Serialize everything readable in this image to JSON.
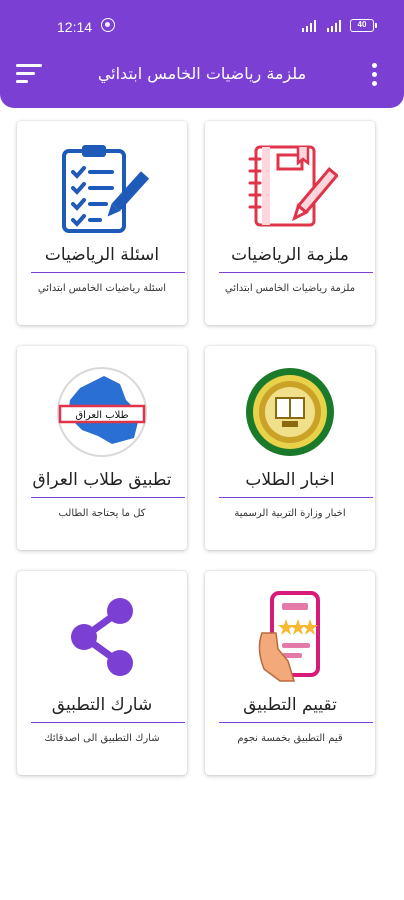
{
  "status_bar": {
    "time": "12:14",
    "battery": "40"
  },
  "app_bar": {
    "title": "ملزمة رياضيات الخامس ابتدائي",
    "menu_icon": "hamburger-menu-icon",
    "more_icon": "more-vert-icon"
  },
  "colors": {
    "primary": "#7b3fd4",
    "rule": "#7b3fd4"
  },
  "cards": [
    {
      "title": "ملزمة الرياضيات",
      "subtitle": "ملزمة رياضيات الخامس ابتدائي",
      "icon": "notebook-pencil-icon"
    },
    {
      "title": "اسئلة الرياضيات",
      "subtitle": "اسئلة رياضيات الخامس ابتدائي",
      "icon": "clipboard-checklist-icon"
    },
    {
      "title": "اخبار الطلاب",
      "subtitle": "اخبار وزارة التربية الرسمية",
      "icon": "ministry-seal-icon"
    },
    {
      "title": "تطبيق طلاب العراق",
      "subtitle": "كل ما يحتاجة الطالب",
      "icon": "iraq-map-logo-icon",
      "logo_text": "طلاب العراق"
    },
    {
      "title": "تقييم التطبيق",
      "subtitle": "قيم التطبيق بخمسة نجوم",
      "icon": "phone-rating-icon"
    },
    {
      "title": "شارك التطبيق",
      "subtitle": "شارك التطبيق الى اصدقائك",
      "icon": "share-icon"
    }
  ]
}
